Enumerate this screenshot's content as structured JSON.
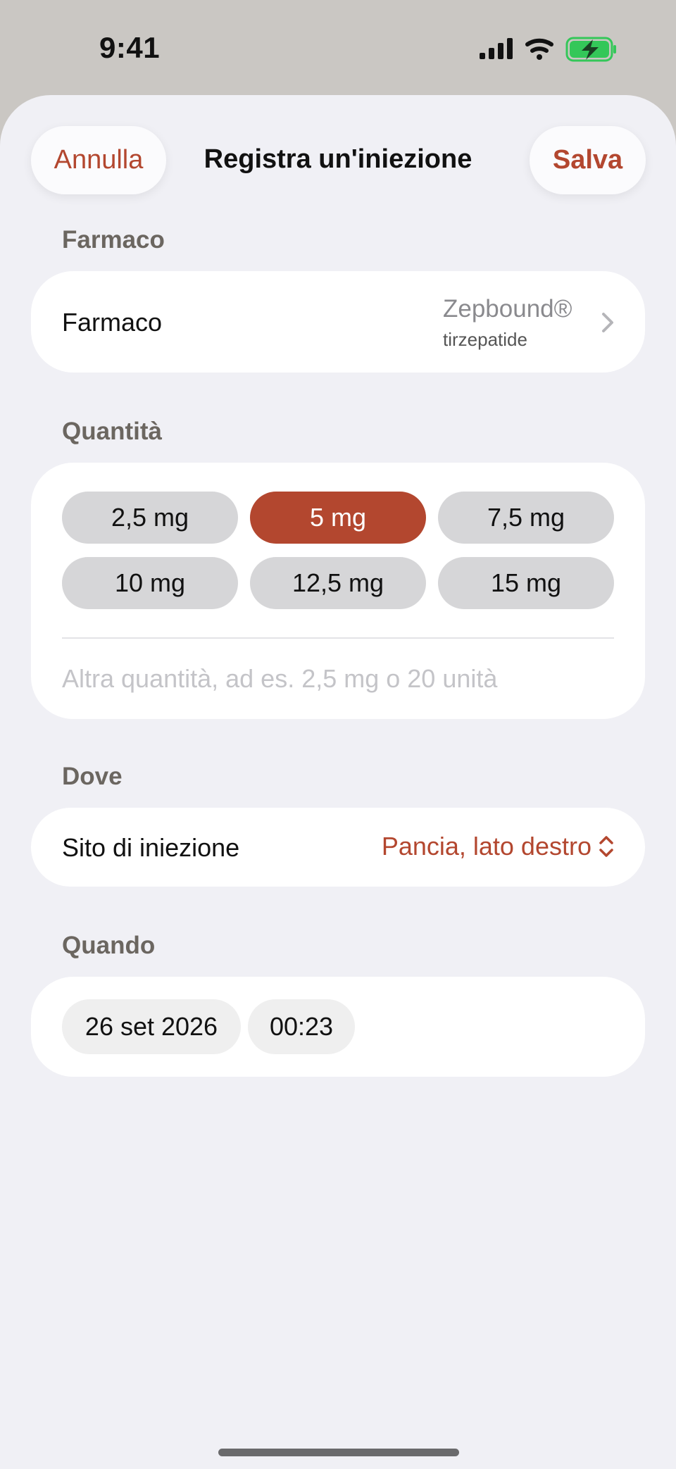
{
  "status_bar": {
    "time": "9:41",
    "icons": [
      "signal-icon",
      "wifi-icon",
      "battery-charging-icon"
    ],
    "battery_color": "#34c759"
  },
  "header": {
    "cancel_label": "Annulla",
    "title": "Registra un'iniezione",
    "save_label": "Salva"
  },
  "colors": {
    "accent": "#b3472f",
    "sheet_background": "#f0f0f5",
    "card_background": "#ffffff",
    "chip_background": "#d6d6d8"
  },
  "medication": {
    "section_title": "Farmaco",
    "row_label": "Farmaco",
    "drug_name": "Zepbound®",
    "drug_generic": "tirzepatide"
  },
  "quantity": {
    "section_title": "Quantità",
    "options": [
      "2,5 mg",
      "5 mg",
      "7,5 mg",
      "10 mg",
      "12,5 mg",
      "15 mg"
    ],
    "selected": "5 mg",
    "custom_value": "",
    "custom_placeholder": "Altra quantità, ad es. 2,5 mg o 20 unità"
  },
  "location": {
    "section_title": "Dove",
    "row_label": "Sito di iniezione",
    "value": "Pancia, lato destro"
  },
  "when": {
    "section_title": "Quando",
    "date": "26 set 2026",
    "time": "00:23"
  }
}
